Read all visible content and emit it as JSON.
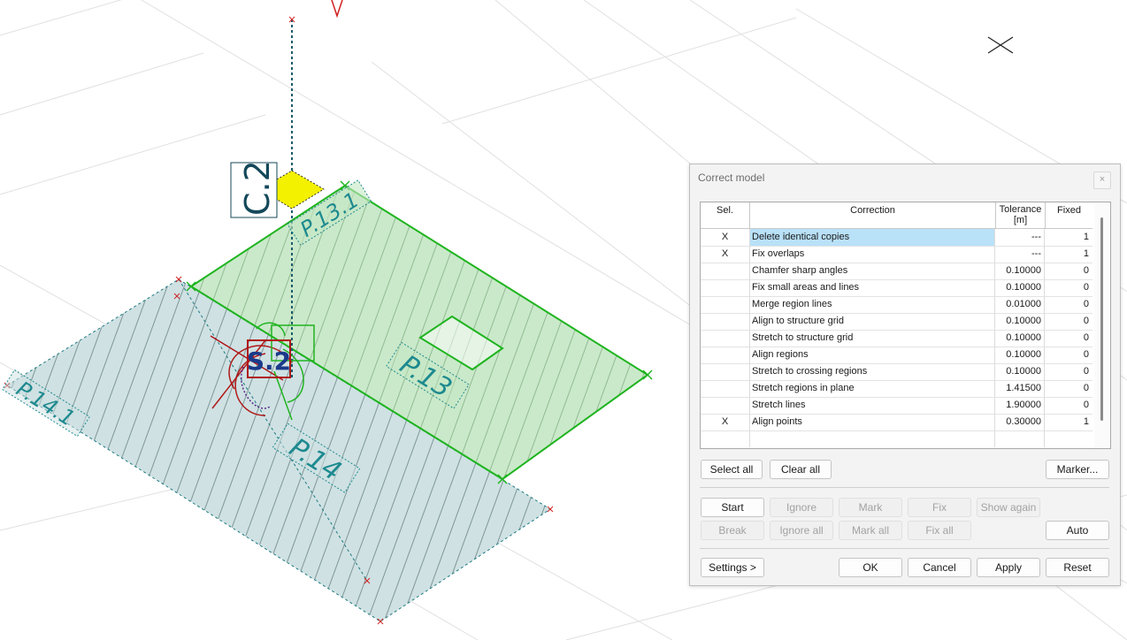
{
  "viewport": {
    "column_label": "C.2",
    "labels": [
      "P.13.1",
      "P.13",
      "S.2",
      "P.14",
      "P.14.1"
    ]
  },
  "dialog": {
    "title": "Correct model",
    "close_glyph": "×",
    "columns": {
      "sel": "Sel.",
      "correction": "Correction",
      "tolerance": "Tolerance [m]",
      "fixed": "Fixed"
    },
    "rows": [
      {
        "sel": "X",
        "correction": "Delete identical copies",
        "tolerance": "---",
        "fixed": "1"
      },
      {
        "sel": "X",
        "correction": "Fix overlaps",
        "tolerance": "---",
        "fixed": "1"
      },
      {
        "sel": "",
        "correction": "Chamfer sharp angles",
        "tolerance": "0.10000",
        "fixed": "0"
      },
      {
        "sel": "",
        "correction": "Fix small areas and lines",
        "tolerance": "0.10000",
        "fixed": "0"
      },
      {
        "sel": "",
        "correction": "Merge region lines",
        "tolerance": "0.01000",
        "fixed": "0"
      },
      {
        "sel": "",
        "correction": "Align to structure grid",
        "tolerance": "0.10000",
        "fixed": "0"
      },
      {
        "sel": "",
        "correction": "Stretch to structure grid",
        "tolerance": "0.10000",
        "fixed": "0"
      },
      {
        "sel": "",
        "correction": "Align regions",
        "tolerance": "0.10000",
        "fixed": "0"
      },
      {
        "sel": "",
        "correction": "Stretch to crossing regions",
        "tolerance": "0.10000",
        "fixed": "0"
      },
      {
        "sel": "",
        "correction": "Stretch regions in plane",
        "tolerance": "1.41500",
        "fixed": "0"
      },
      {
        "sel": "",
        "correction": "Stretch lines",
        "tolerance": "1.90000",
        "fixed": "0"
      },
      {
        "sel": "X",
        "correction": "Align points",
        "tolerance": "0.30000",
        "fixed": "1"
      }
    ],
    "buttons": {
      "select_all": "Select all",
      "clear_all": "Clear all",
      "marker": "Marker...",
      "start": "Start",
      "ignore": "Ignore",
      "mark": "Mark",
      "fix": "Fix",
      "show_again": "Show again",
      "break": "Break",
      "ignore_all": "Ignore all",
      "mark_all": "Mark all",
      "fix_all": "Fix all",
      "auto": "Auto",
      "settings": "Settings >",
      "ok": "OK",
      "cancel": "Cancel",
      "apply": "Apply",
      "reset": "Reset"
    }
  },
  "colors": {
    "slab_green_fill": "#c4e7c4",
    "slab_green_line": "#1fb41f",
    "slab_teal_fill": "#cfe1e3",
    "slab_teal_line": "#1b7a80",
    "label_teal": "#1e8a8f",
    "column_yellow": "#f3f000",
    "label_dark": "#14485a",
    "red": "#c01818",
    "highlight": "#b9e1f8"
  }
}
